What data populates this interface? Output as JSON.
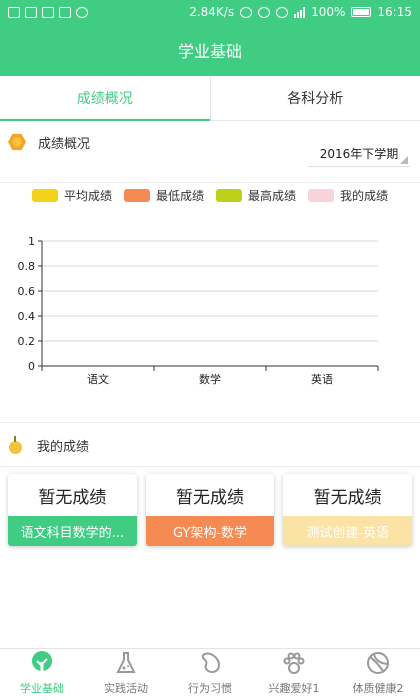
{
  "status_bar": {
    "speed": "2.84K/s",
    "battery": "100%",
    "time": "16:15"
  },
  "header": {
    "title": "学业基础"
  },
  "tabs": [
    {
      "label": "成绩概况",
      "active": true
    },
    {
      "label": "各科分析",
      "active": false
    }
  ],
  "overview": {
    "title": "成绩概况",
    "semester": "2016年下学期"
  },
  "legend": [
    {
      "label": "平均成绩",
      "color": "#f5d21a"
    },
    {
      "label": "最低成绩",
      "color": "#f58b52"
    },
    {
      "label": "最高成绩",
      "color": "#bdd11b"
    },
    {
      "label": "我的成绩",
      "color": "#f7d3dc"
    }
  ],
  "chart_data": {
    "type": "bar",
    "categories": [
      "语文",
      "数学",
      "英语"
    ],
    "series": [],
    "ylim": [
      0,
      1
    ],
    "yticks": [
      "0",
      "0.2",
      "0.4",
      "0.6",
      "0.8",
      "1"
    ],
    "grid": true,
    "legend_position": "top"
  },
  "my_scores": {
    "title": "我的成绩",
    "cards": [
      {
        "value": "暂无成绩",
        "label": "语文科目数学的...",
        "color": "#41cc83"
      },
      {
        "value": "暂无成绩",
        "label": "GY架构-数学",
        "color": "#f58b52"
      },
      {
        "value": "暂无成绩",
        "label": "测试创建-英语",
        "color": "#fbe3a6"
      }
    ]
  },
  "bottom_nav": [
    {
      "label": "学业基础",
      "icon": "tree-icon",
      "active": true
    },
    {
      "label": "实践活动",
      "icon": "flask-icon",
      "active": false
    },
    {
      "label": "行为习惯",
      "icon": "bean-icon",
      "active": false
    },
    {
      "label": "兴趣爱好1",
      "icon": "paw-icon",
      "active": false
    },
    {
      "label": "体质健康2",
      "icon": "ball-icon",
      "active": false
    }
  ]
}
